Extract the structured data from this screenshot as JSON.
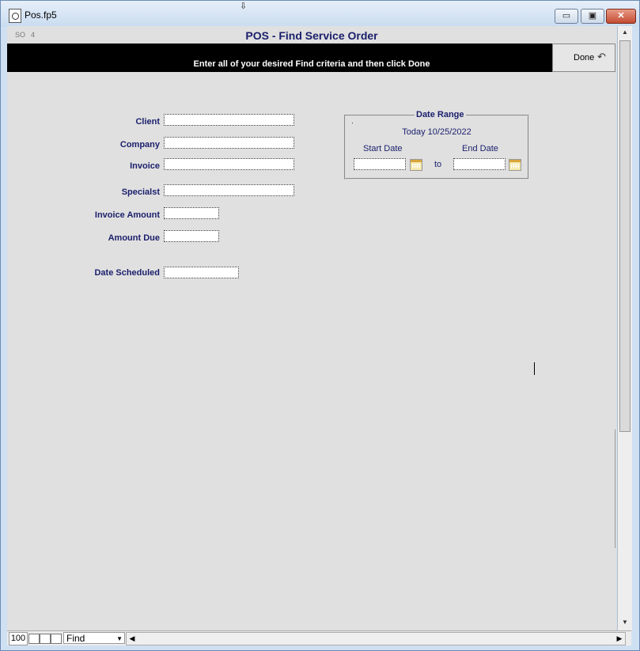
{
  "window": {
    "title": "Pos.fp5",
    "minimize": "▭",
    "maximize": "▣",
    "close": "✕"
  },
  "header": {
    "so_label": "SO",
    "so_number": "4",
    "title": "POS - Find Service Order",
    "instruction": "Enter all of your desired Find criteria and then click Done",
    "done_label": "Done"
  },
  "fields": {
    "client": "Client",
    "company": "Company",
    "invoice": "Invoice",
    "specialist": "Specialst",
    "invoice_amount": "Invoice Amount",
    "amount_due": "Amount Due",
    "date_scheduled": "Date Scheduled"
  },
  "date_range": {
    "title": "Date Range",
    "today": "Today 10/25/2022",
    "start_label": "Start Date",
    "end_label": "End Date",
    "to": "to"
  },
  "statusbar": {
    "zoom": "100",
    "mode": "Find"
  },
  "icons": {
    "file": "file-icon",
    "done": "undo-arrow-icon",
    "calendar": "calendar-icon"
  }
}
